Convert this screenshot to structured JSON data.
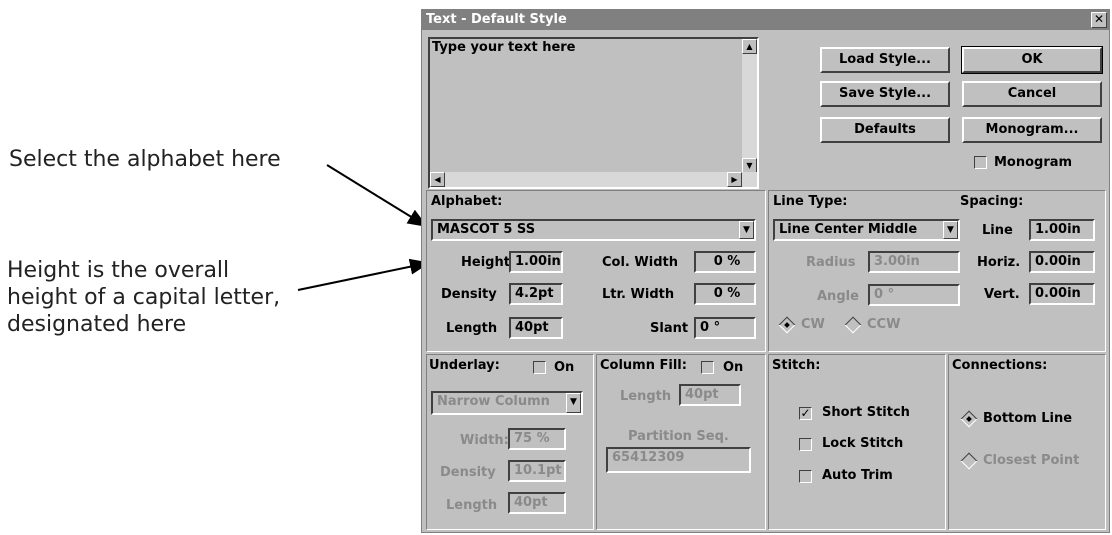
{
  "annotations": {
    "alphabet_note": "Select the alphabet here",
    "height_note_lines": [
      "Height is the overall",
      "height of a capital letter,",
      "designated here"
    ]
  },
  "window": {
    "title": "Text - Default Style",
    "close_glyph": "✕"
  },
  "text_area": {
    "value": "Type your text here"
  },
  "buttons": {
    "load_style": "Load Style...",
    "save_style": "Save Style...",
    "defaults": "Defaults",
    "ok": "OK",
    "cancel": "Cancel",
    "monogram_btn": "Monogram..."
  },
  "monogram_checkbox": {
    "label": "Monogram",
    "checked": false
  },
  "alphabet": {
    "label": "Alphabet:",
    "selected": "MASCOT 5 SS",
    "height_label": "Height",
    "height_value": "1.00in",
    "density_label": "Density",
    "density_value": "4.2pt",
    "length_label": "Length",
    "length_value": "40pt",
    "col_width_label": "Col. Width",
    "col_width_value": "0 %",
    "ltr_width_label": "Ltr. Width",
    "ltr_width_value": "0 %",
    "slant_label": "Slant",
    "slant_value": "0 °"
  },
  "line_type": {
    "label": "Line Type:",
    "selected": "Line Center Middle",
    "radius_label": "Radius",
    "radius_value": "3.00in",
    "angle_label": "Angle",
    "angle_value": "0 °",
    "cw_label": "CW",
    "ccw_label": "CCW"
  },
  "spacing": {
    "label": "Spacing:",
    "line_label": "Line",
    "line_value": "1.00in",
    "horiz_label": "Horiz.",
    "horiz_value": "0.00in",
    "vert_label": "Vert.",
    "vert_value": "0.00in"
  },
  "underlay": {
    "label": "Underlay:",
    "on_label": "On",
    "selected": "Narrow Column",
    "width_label": "Width:",
    "width_value": "75 %",
    "density_label": "Density",
    "density_value": "10.1pt",
    "length_label": "Length",
    "length_value": "40pt"
  },
  "column_fill": {
    "label": "Column Fill:",
    "on_label": "On",
    "length_label": "Length",
    "length_value": "40pt",
    "partition_label": "Partition Seq.",
    "partition_value": "65412309"
  },
  "stitch": {
    "label": "Stitch:",
    "short_stitch": "Short Stitch",
    "lock_stitch": "Lock Stitch",
    "auto_trim": "Auto Trim",
    "check_glyph": "✓"
  },
  "connections": {
    "label": "Connections:",
    "bottom_line": "Bottom Line",
    "closest_point": "Closest Point"
  }
}
